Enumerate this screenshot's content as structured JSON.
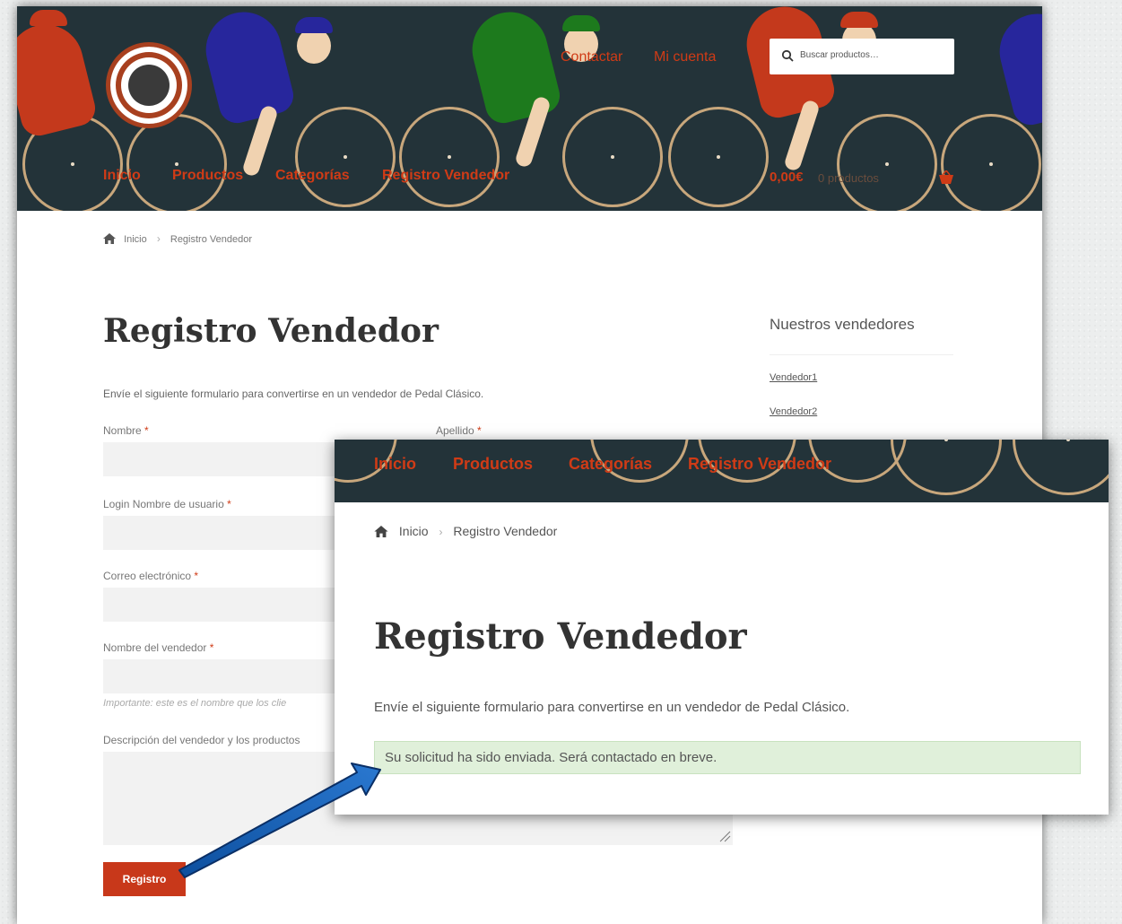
{
  "header": {
    "top_links": [
      "Contactar",
      "Mi cuenta"
    ],
    "search_placeholder": "Buscar productos…",
    "nav": [
      "Inicio",
      "Productos",
      "Categorías",
      "Registro Vendedor"
    ],
    "cart_amount": "0,00€",
    "cart_count": "0 productos"
  },
  "breadcrumb": {
    "home": "Inicio",
    "current": "Registro Vendedor"
  },
  "page": {
    "title": "Registro Vendedor",
    "intro": "Envíe el siguiente formulario para convertirse en un vendedor de Pedal Clásico."
  },
  "form": {
    "first_name_label": "Nombre",
    "last_name_label": "Apellido",
    "username_label": "Login Nombre de usuario",
    "email_label": "Correo electrónico",
    "vendor_name_label": "Nombre del vendedor",
    "vendor_name_hint": "Importante: este es el nombre que los clie",
    "description_label": "Descripción del vendedor y los productos",
    "required_mark": "*",
    "submit_label": "Registro"
  },
  "sidebar": {
    "title": "Nuestros vendedores",
    "vendors": [
      "Vendedor1",
      "Vendedor2"
    ]
  },
  "result": {
    "nav": [
      "Inicio",
      "Productos",
      "Categorías",
      "Registro Vendedor"
    ],
    "breadcrumb_home": "Inicio",
    "breadcrumb_current": "Registro Vendedor",
    "title": "Registro Vendedor",
    "intro": "Envíe el siguiente formulario para convertirse en un vendedor de Pedal Clásico.",
    "notice": "Su solicitud ha sido enviada. Será contactado en breve."
  },
  "colors": {
    "header_bg": "#233339",
    "accent": "#d03b16",
    "notice_bg": "#e0f0da",
    "arrow": "#1a5fb0"
  },
  "icons": [
    "home-icon",
    "search-icon",
    "cart-icon",
    "resize-handle-icon",
    "arrow-annotation"
  ]
}
